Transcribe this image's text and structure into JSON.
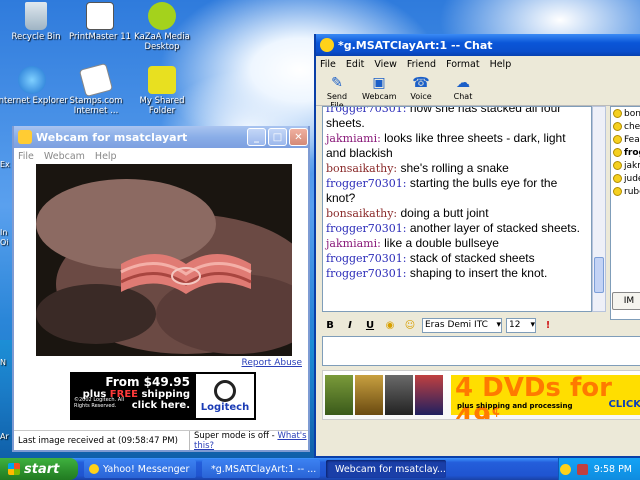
{
  "desktop": {
    "icons": [
      {
        "label": "Recycle Bin"
      },
      {
        "label": "PrintMaster 11"
      },
      {
        "label": "KaZaA Media Desktop"
      },
      {
        "label": "Internet Explorer"
      },
      {
        "label": "Stamps.com Internet ..."
      },
      {
        "label": "My Shared Folder"
      }
    ],
    "edge_labels": [
      "Ex",
      "In",
      "Oi",
      "Ar",
      "N"
    ]
  },
  "webcam_window": {
    "title": "Webcam for msatclayart",
    "menu": [
      "File",
      "Webcam",
      "Help"
    ],
    "report_abuse": "Report Abuse",
    "ad": {
      "line1": "From $49.95",
      "line2_prefix": "plus ",
      "line2_free": "FREE",
      "line2_suffix": " shipping",
      "line3": "click here.",
      "fine": "©2002 Logitech. All Rights Reserved.",
      "brand": "Logitech"
    },
    "status_left": "Last image received at (09:58:47 PM)",
    "status_right_prefix": "Super mode is off - ",
    "status_right_link": "What's this?"
  },
  "chat_window": {
    "title": "*g.MSATClayArt:1 -- Chat",
    "menu": [
      "File",
      "Edit",
      "View",
      "Friend",
      "Format",
      "Help"
    ],
    "toolbar": [
      {
        "label": "Send File",
        "icon": "send-file-icon"
      },
      {
        "label": "Webcam",
        "icon": "webcam-icon"
      },
      {
        "label": "Voice",
        "icon": "voice-icon"
      },
      {
        "label": "Chat",
        "icon": "chat-icon"
      }
    ],
    "messages": [
      {
        "nick": "frogger70301:",
        "text": "how she has stacked all four sheets.",
        "color": "#2a2ab8"
      },
      {
        "nick": "jakmiami:",
        "text": "looks like three sheets - dark, light and blackish",
        "color": "#8a1a7a"
      },
      {
        "nick": "bonsaikathy:",
        "text": "she's rolling a snake",
        "color": "#8a2a2a"
      },
      {
        "nick": "frogger70301:",
        "text": "starting the bulls eye for the knot?",
        "color": "#2a2ab8"
      },
      {
        "nick": "bonsaikathy:",
        "text": "doing a butt joint",
        "color": "#8a2a2a"
      },
      {
        "nick": "frogger70301:",
        "text": "another layer of stacked sheets.",
        "color": "#2a2ab8"
      },
      {
        "nick": "jakmiami:",
        "text": "like a double bullseye",
        "color": "#8a1a7a"
      },
      {
        "nick": "frogger70301:",
        "text": "stack of stacked sheets",
        "color": "#2a2ab8"
      },
      {
        "nick": "frogger70301:",
        "text": "shaping to insert the knot.",
        "color": "#2a2ab8"
      }
    ],
    "users": [
      {
        "name": "bonsa",
        "bold": false
      },
      {
        "name": "chelyh",
        "bold": false
      },
      {
        "name": "Fearle",
        "bold": false
      },
      {
        "name": "frogg",
        "bold": true
      },
      {
        "name": "jakmia",
        "bold": false
      },
      {
        "name": "jude",
        "bold": false
      },
      {
        "name": "rubens",
        "bold": false
      }
    ],
    "im_button": "IM",
    "format": {
      "bold": "B",
      "italic": "I",
      "underline": "U",
      "font": "Eras Demi ITC",
      "size": "12"
    },
    "compose_value": "",
    "ad": {
      "big": "4 DVDs for 49",
      "cents": "¢",
      "sub": "plus shipping and processing",
      "click": "CLICK"
    }
  },
  "taskbar": {
    "start": "start",
    "tasks": [
      {
        "label": "Yahoo! Messenger",
        "active": false
      },
      {
        "label": "*g.MSATClayArt:1 -- ...",
        "active": false
      },
      {
        "label": "Webcam for msatclay...",
        "active": true
      }
    ],
    "clock": "9:58 PM"
  }
}
